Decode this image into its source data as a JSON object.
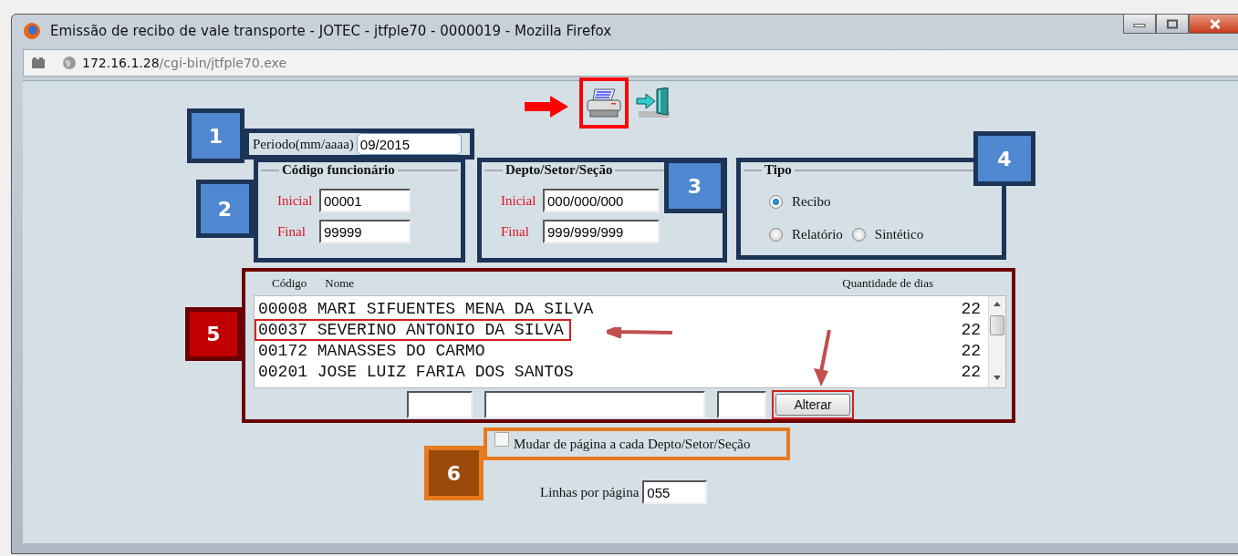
{
  "window": {
    "title": "Emissão de recibo de vale transporte - JOTEC - jtfple70 - 0000019 - Mozilla Firefox",
    "url_host": "172.16.1.28",
    "url_path": "/cgi-bin/jtfple70.exe"
  },
  "toolbar": [
    {
      "kind": "print",
      "highlighted": true
    },
    {
      "kind": "exit",
      "highlighted": false
    }
  ],
  "callouts": [
    {
      "label": "1",
      "color": "#4f88d0"
    },
    {
      "label": "2",
      "color": "#4f88d0"
    },
    {
      "label": "3",
      "color": "#4f88d0"
    },
    {
      "label": "4",
      "color": "#4f88d0"
    },
    {
      "label": "5",
      "color": "#c00000"
    },
    {
      "label": "6",
      "color": "#9a4a0a"
    }
  ],
  "periodo": {
    "label": "Periodo(mm/aaaa)",
    "value": "09/2015"
  },
  "codigo_funcionario": {
    "legend": "Código funcionário",
    "inicial_label": "Inicial",
    "inicial": "00001",
    "final_label": "Final",
    "final": "99999"
  },
  "depto": {
    "legend": "Depto/Setor/Seção",
    "inicial_label": "Inicial",
    "inicial": "000/000/000",
    "final_label": "Final",
    "final": "999/999/999"
  },
  "tipo": {
    "legend": "Tipo",
    "options": [
      {
        "label": "Recibo",
        "selected": true
      },
      {
        "label": "Relatório",
        "selected": false
      },
      {
        "label": "Sintético",
        "selected": false
      }
    ]
  },
  "list": {
    "columns": [
      "Código",
      "Nome",
      "Quantidade de dias"
    ],
    "rows": [
      {
        "code": "00008",
        "name": "MARI SIFUENTES MENA DA SILVA",
        "days": "22",
        "highlighted": false
      },
      {
        "code": "00037",
        "name": "SEVERINO ANTONIO DA SILVA",
        "days": "22",
        "highlighted": true
      },
      {
        "code": "00172",
        "name": "MANASSES DO CARMO",
        "days": "22",
        "highlighted": false
      },
      {
        "code": "00201",
        "name": "JOSE LUIZ FARIA DOS SANTOS",
        "days": "22",
        "highlighted": false
      }
    ]
  },
  "alterar": {
    "label": "Alterar",
    "highlighted": true
  },
  "page_break": {
    "label": "Mudar de página a cada Depto/Setor/Seção",
    "checked": false
  },
  "linhas": {
    "label": "Linhas por página",
    "value": "055"
  }
}
